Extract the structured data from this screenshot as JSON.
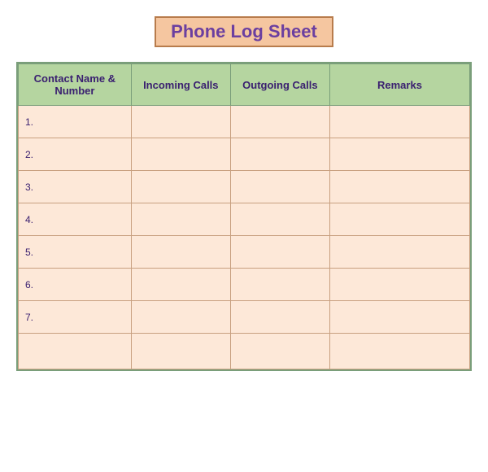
{
  "title": "Phone Log Sheet",
  "columns": [
    {
      "label": "Contact Name & Number"
    },
    {
      "label": "Incoming Calls"
    },
    {
      "label": "Outgoing Calls"
    },
    {
      "label": "Remarks"
    }
  ],
  "rows": [
    {
      "num": "1."
    },
    {
      "num": "2."
    },
    {
      "num": "3."
    },
    {
      "num": "4."
    },
    {
      "num": "5."
    },
    {
      "num": "6."
    },
    {
      "num": "7."
    },
    {
      "num": ""
    }
  ]
}
